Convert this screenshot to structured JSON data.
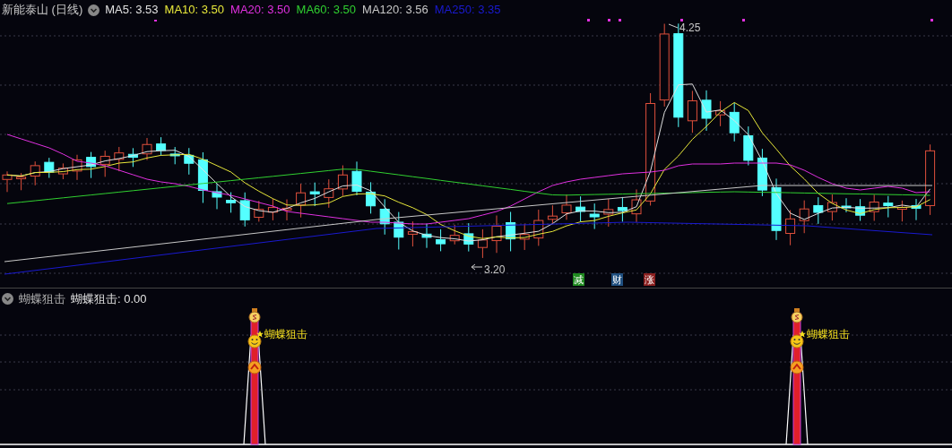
{
  "header": {
    "title": "新能泰山 (日线)",
    "indicators": [
      {
        "label": "MA5: 3.53",
        "color": "#e0e0e0"
      },
      {
        "label": "MA10: 3.50",
        "color": "#e8e83a"
      },
      {
        "label": "MA20: 3.50",
        "color": "#e030e0"
      },
      {
        "label": "MA60: 3.50",
        "color": "#30d030"
      },
      {
        "label": "MA120: 3.56",
        "color": "#c8c8c8"
      },
      {
        "label": "MA250: 3.35",
        "color": "#1a1ad0"
      }
    ]
  },
  "price_labels": {
    "high": "4.25",
    "low": "3.20"
  },
  "event_markers": [
    {
      "label": "减",
      "color": "#1f8a1f"
    },
    {
      "label": "财",
      "color": "#1f4f7f"
    },
    {
      "label": "涨",
      "color": "#8a1f1f"
    }
  ],
  "lower_panel": {
    "title": "蝴蝶狙击",
    "value": "蝴蝶狙击: 0.00",
    "signals": [
      {
        "label": "蝴蝶狙击"
      },
      {
        "label": "蝴蝶狙击"
      }
    ]
  }
}
